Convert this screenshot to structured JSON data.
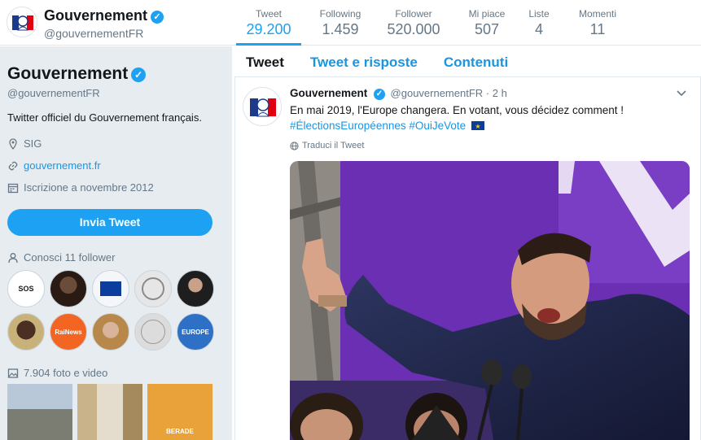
{
  "profile": {
    "name": "Gouvernement",
    "handle": "@gouvernementFR",
    "bio": "Twitter officiel du Gouvernement français.",
    "location": "SIG",
    "website": "gouvernement.fr",
    "joined": "Iscrizione a novembre 2012",
    "tweet_button": "Invia Tweet",
    "followers_you_know": "Conosci 11 follower",
    "photos_videos": "7.904 foto e video",
    "follower_labels": [
      "SOS",
      "",
      "",
      "",
      "",
      "",
      "RaiNews",
      "",
      "",
      "EUROPE"
    ],
    "photo_labels": [
      "",
      "",
      "BERADE"
    ]
  },
  "stats": [
    {
      "label": "Tweet",
      "value": "29.200"
    },
    {
      "label": "Following",
      "value": "1.459"
    },
    {
      "label": "Follower",
      "value": "520.000"
    },
    {
      "label": "Mi piace",
      "value": "507"
    },
    {
      "label": "Liste",
      "value": "4"
    },
    {
      "label": "Momenti",
      "value": "11"
    }
  ],
  "tabs": [
    "Tweet",
    "Tweet e risposte",
    "Contenuti"
  ],
  "tweet": {
    "name": "Gouvernement",
    "handle": "@gouvernementFR",
    "sep": "·",
    "time": "2 h",
    "text_line1": "En mai 2019, l'Europe changera. En votant, vous décidez comment !",
    "hashtag1": "#ÉlectionsEuropéennes",
    "hashtag2": "#OuiJeVote",
    "translate": "Traduci il Tweet"
  },
  "colors": {
    "accent": "#1da1f2",
    "link": "#1b95e0",
    "sidebar_bg": "#e6ecf0",
    "purple_banner": "#6a2fb3"
  },
  "icons": [
    "verified-badge-icon",
    "location-pin-icon",
    "link-icon",
    "calendar-icon",
    "person-icon",
    "photo-icon",
    "globe-icon",
    "chevron-down-icon"
  ]
}
